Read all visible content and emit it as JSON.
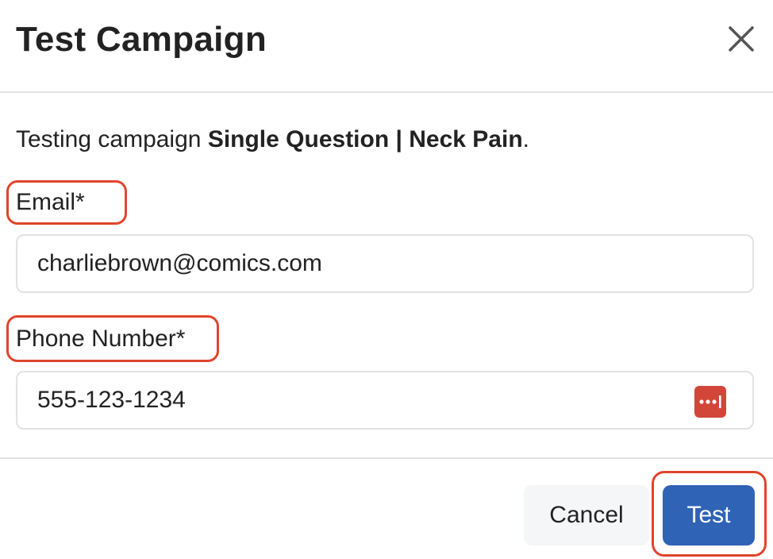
{
  "dialog": {
    "title": "Test Campaign",
    "close_icon": "close-icon"
  },
  "body": {
    "intro_prefix": "Testing campaign ",
    "campaign_name": "Single Question | Neck Pain",
    "intro_suffix": ".",
    "email": {
      "label": "Email*",
      "value": "charliebrown@comics.com"
    },
    "phone": {
      "label": "Phone Number*",
      "value": "555-123-1234",
      "autofill_icon": "password-manager-icon"
    }
  },
  "footer": {
    "cancel_label": "Cancel",
    "test_label": "Test"
  },
  "colors": {
    "primary_button": "#2f63b6",
    "highlight_outline": "#e0452b",
    "password_manager_icon": "#d2463a",
    "cancel_button_bg": "#f5f6f7"
  }
}
